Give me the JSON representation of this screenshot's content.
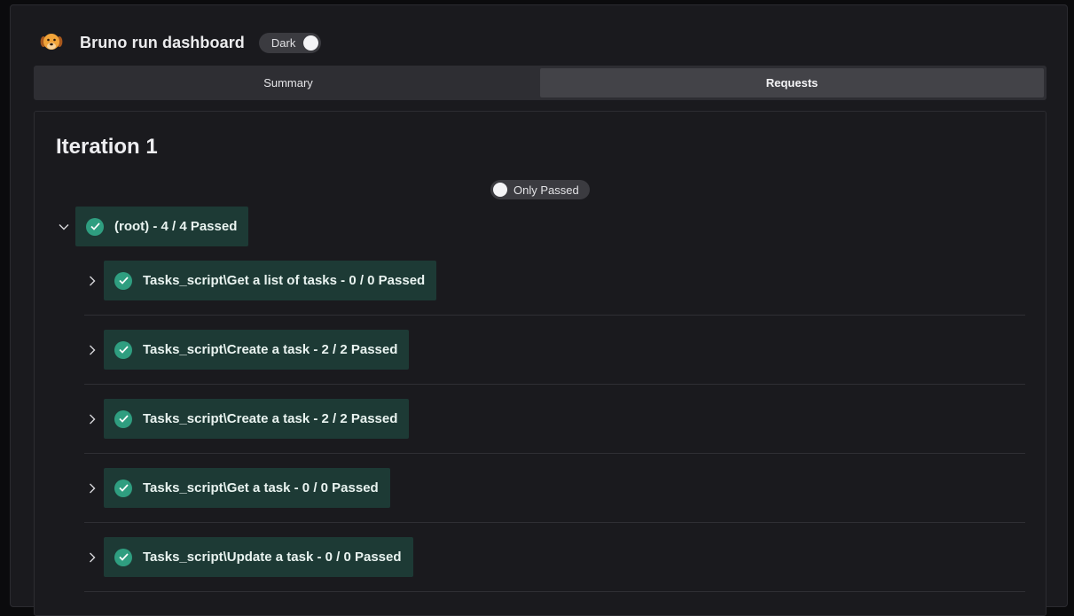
{
  "header": {
    "app_title": "Bruno run dashboard",
    "theme_toggle_label": "Dark",
    "logo_icon": "bruno-dog-logo-icon"
  },
  "tabs": [
    {
      "label": "Summary",
      "active": false
    },
    {
      "label": "Requests",
      "active": true
    }
  ],
  "main": {
    "iteration_title": "Iteration 1",
    "filter_toggle_label": "Only Passed",
    "root": {
      "label": "(root) - 4 / 4 Passed",
      "status": "passed",
      "expanded": true
    },
    "requests": [
      {
        "label": "Tasks_script\\Get a list of tasks - 0 / 0 Passed",
        "status": "passed"
      },
      {
        "label": "Tasks_script\\Create a task - 2 / 2 Passed",
        "status": "passed"
      },
      {
        "label": "Tasks_script\\Create a task - 2 / 2 Passed",
        "status": "passed"
      },
      {
        "label": "Tasks_script\\Get a task - 0 / 0 Passed",
        "status": "passed"
      },
      {
        "label": "Tasks_script\\Update a task - 0 / 0 Passed",
        "status": "passed"
      }
    ]
  },
  "colors": {
    "background": "#1a1a1e",
    "badge_bg": "#1d3a35",
    "check_green": "#2f9e80",
    "tab_active": "#434348"
  }
}
